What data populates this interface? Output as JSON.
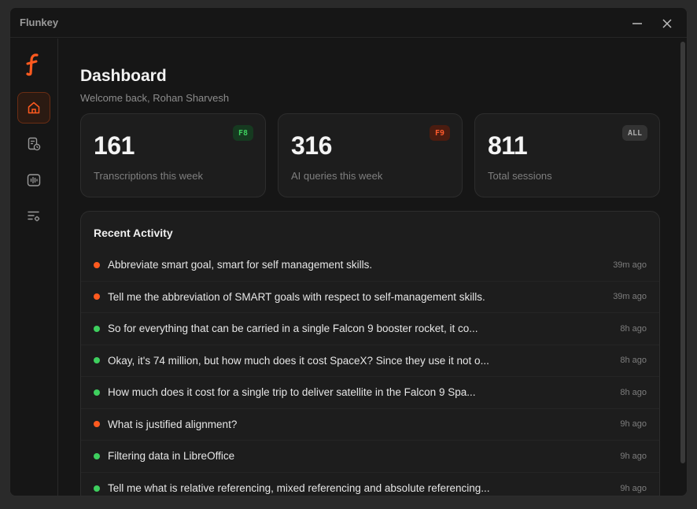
{
  "window": {
    "title": "Flunkey"
  },
  "header": {
    "title": "Dashboard",
    "subtitle": "Welcome back, Rohan Sharvesh"
  },
  "stats": [
    {
      "value": "161",
      "label": "Transcriptions this week",
      "badge": "F8",
      "badge_color": "#3ecf5e",
      "badge_bg": "#163a20"
    },
    {
      "value": "316",
      "label": "AI queries this week",
      "badge": "F9",
      "badge_color": "#ff5a2c",
      "badge_bg": "#4a1c10"
    },
    {
      "value": "811",
      "label": "Total sessions",
      "badge": "ALL",
      "badge_color": "#a8a8a8",
      "badge_bg": "#333333"
    }
  ],
  "activity": {
    "title": "Recent Activity",
    "items": [
      {
        "text": "Abbreviate smart goal, smart for self management skills.",
        "time": "39m ago",
        "status": "orange"
      },
      {
        "text": "Tell me the abbreviation of SMART goals with respect to self-management skills.",
        "time": "39m ago",
        "status": "orange"
      },
      {
        "text": "So for everything that can be carried in a single Falcon 9 booster rocket, it co...",
        "time": "8h ago",
        "status": "green"
      },
      {
        "text": "Okay, it's 74 million, but how much does it cost SpaceX? Since they use it not o...",
        "time": "8h ago",
        "status": "green"
      },
      {
        "text": "How much does it cost for a single trip to deliver satellite in the Falcon 9 Spa...",
        "time": "8h ago",
        "status": "green"
      },
      {
        "text": "What is justified alignment?",
        "time": "9h ago",
        "status": "orange"
      },
      {
        "text": "Filtering data in LibreOffice",
        "time": "9h ago",
        "status": "green"
      },
      {
        "text": "Tell me what is relative referencing, mixed referencing and absolute referencing...",
        "time": "9h ago",
        "status": "green"
      }
    ]
  },
  "colors": {
    "accent": "#ff5a1f",
    "green": "#3ecf5e",
    "orange": "#ff5a1f"
  },
  "sidebar": {
    "items": [
      {
        "icon": "home-icon",
        "active": true
      },
      {
        "icon": "history-icon",
        "active": false
      },
      {
        "icon": "audio-wave-icon",
        "active": false
      },
      {
        "icon": "settings-list-icon",
        "active": false
      }
    ]
  }
}
